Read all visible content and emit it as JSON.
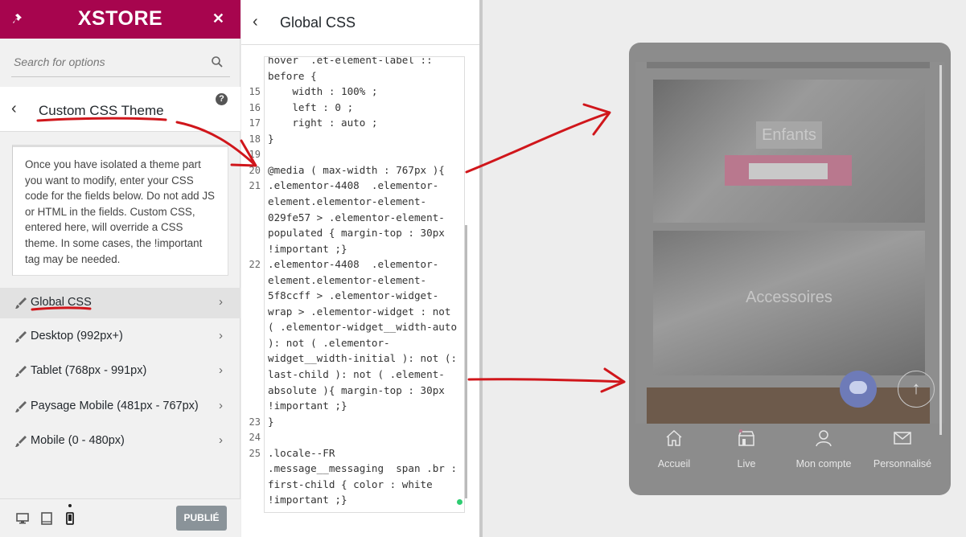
{
  "left_panel": {
    "brand": "XSTORE",
    "search": {
      "placeholder": "Search for options"
    },
    "section_title": "Custom CSS Theme",
    "help_icon": "?",
    "description": "Once you have isolated a theme part you want to modify, enter your CSS code for the fields below. Do not add JS or HTML in the fields. Custom CSS, entered here, will override a CSS theme. In some cases, the !important tag may be needed.",
    "options": [
      {
        "label": "Global CSS"
      },
      {
        "label": "Desktop (992px+)"
      },
      {
        "label": "Tablet (768px - 991px)"
      },
      {
        "label": "Paysage Mobile (481px - 767px)"
      },
      {
        "label": "Mobile (0 - 480px)"
      }
    ],
    "publish_label": "PUBLIÉ"
  },
  "editor": {
    "title": "Global CSS",
    "line_numbers": [
      "15",
      "16",
      "17",
      "18",
      "19",
      "20",
      "21",
      "22",
      "23",
      "24",
      "25"
    ],
    "code_lines": [
      "hover  .et-element-label ::",
      "before {",
      "    width : 100% ;",
      "    left : 0 ;",
      "    right : auto ;",
      "}",
      "",
      "@media ( max-width : 767px ){",
      ".elementor-4408  .elementor-",
      "element.elementor-element-",
      "029fe57 > .elementor-element-",
      "populated { margin-top : 30px",
      "!important ;}",
      ".elementor-4408  .elementor-",
      "element.elementor-element-",
      "5f8ccff > .elementor-widget-",
      "wrap > .elementor-widget : not",
      "( .elementor-widget__width-auto",
      "): not ( .elementor-",
      "widget__width-initial ): not (:",
      "last-child ): not ( .element-",
      "absolute ){ margin-top : 30px",
      "!important ;}",
      "}",
      "",
      ".locale--FR",
      ".message__messaging  span .br :",
      "first-child { color : white",
      "!important ;}"
    ]
  },
  "preview": {
    "card1_label": "Enfants",
    "card2_label": "Accessoires",
    "tabs": [
      {
        "label": "Accueil",
        "icon": "home-icon"
      },
      {
        "label": "Live",
        "icon": "store-icon"
      },
      {
        "label": "Mon compte",
        "icon": "user-icon"
      },
      {
        "label": "Personnalisé",
        "icon": "mail-icon"
      }
    ],
    "up_arrow": "↑"
  },
  "colors": {
    "brand": "#a7054e",
    "annotation": "#d0161b"
  }
}
